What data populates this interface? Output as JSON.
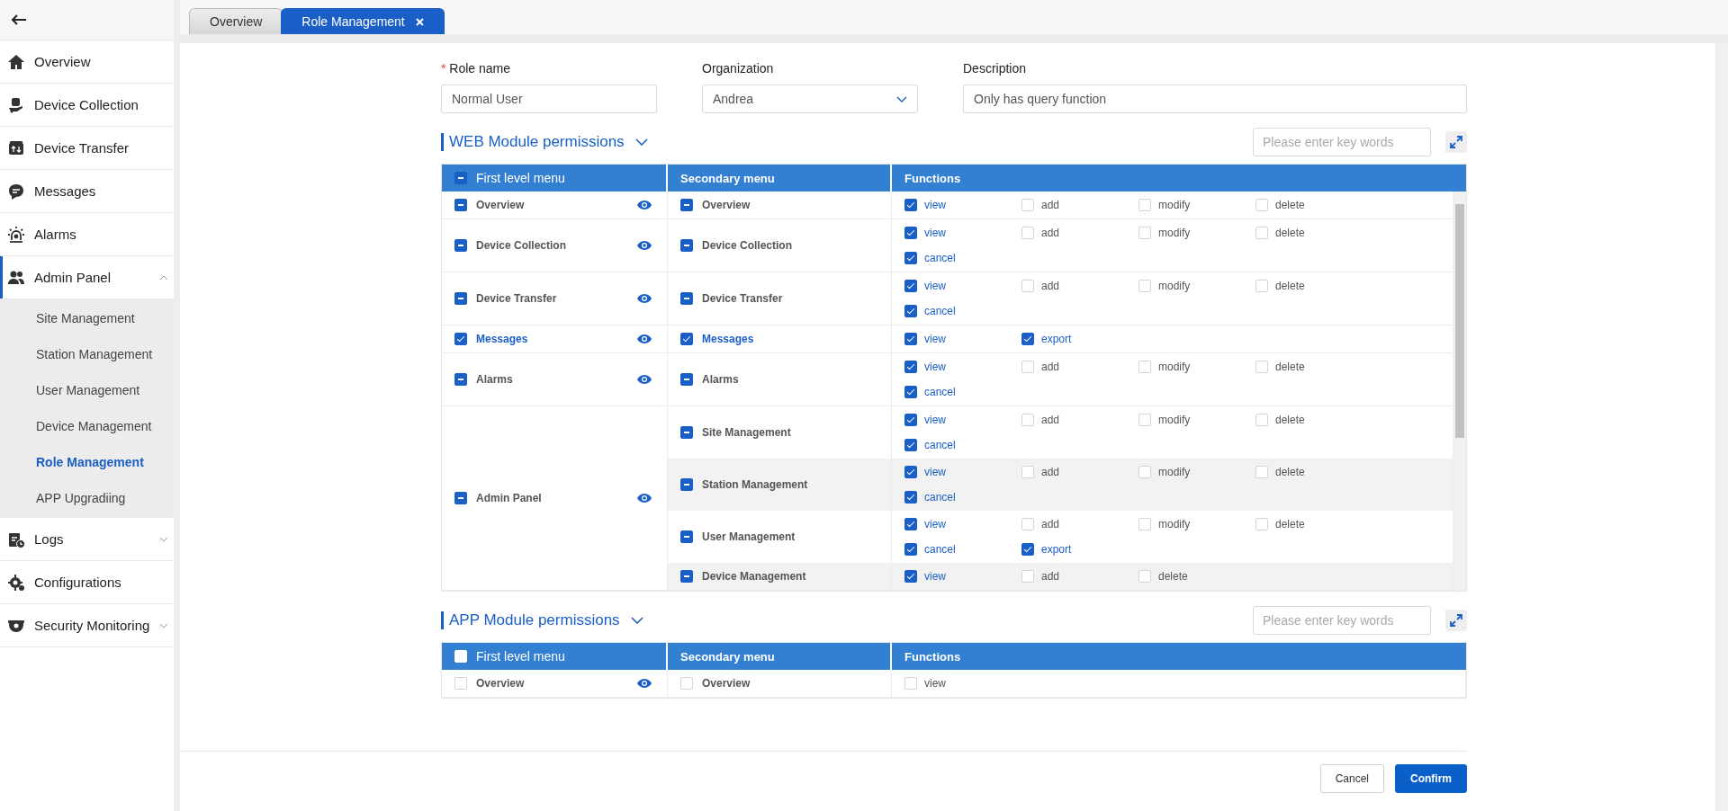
{
  "sidebar": {
    "items": [
      {
        "label": "Overview",
        "selected": false
      },
      {
        "label": "Device Collection",
        "selected": false
      },
      {
        "label": "Device Transfer",
        "selected": false
      },
      {
        "label": "Messages",
        "selected": false
      },
      {
        "label": "Alarms",
        "selected": false
      },
      {
        "label": "Admin Panel",
        "selected": true,
        "expanded": true,
        "children": [
          {
            "label": "Site Management",
            "selected": false
          },
          {
            "label": "Station Management",
            "selected": false
          },
          {
            "label": "User Management",
            "selected": false
          },
          {
            "label": "Device Management",
            "selected": false
          },
          {
            "label": "Role Management",
            "selected": true
          },
          {
            "label": "APP Upgradiing",
            "selected": false
          }
        ]
      },
      {
        "label": "Logs",
        "selected": false,
        "expanded": false
      },
      {
        "label": "Configurations",
        "selected": false
      },
      {
        "label": "Security Monitoring",
        "selected": false,
        "expanded": false
      }
    ]
  },
  "tabs": [
    {
      "label": "Overview",
      "selected": false,
      "closable": false
    },
    {
      "label": "Role Management",
      "selected": true,
      "closable": true
    }
  ],
  "form": {
    "role_name": {
      "label": "Role name",
      "required": true,
      "required_mark": "*",
      "value": "Normal User"
    },
    "organization": {
      "label": "Organization",
      "value": "Andrea"
    },
    "description": {
      "label": "Description",
      "value": "Only has query function"
    }
  },
  "web": {
    "title": "WEB Module permissions",
    "search_placeholder": "Please enter key words",
    "header_checked": true,
    "header_partial": true,
    "columns": [
      "First level menu",
      "Secondary menu",
      "Functions"
    ],
    "rows": [
      {
        "name": "Overview",
        "checked": true,
        "partial": true,
        "children": [
          {
            "name": "Overview",
            "checked": true,
            "partial": true,
            "functions": [
              {
                "label": "view",
                "checked": true
              },
              {
                "label": "add",
                "checked": false
              },
              {
                "label": "modify",
                "checked": false
              },
              {
                "label": "delete",
                "checked": false
              }
            ]
          }
        ]
      },
      {
        "name": "Device Collection",
        "checked": true,
        "partial": true,
        "children": [
          {
            "name": "Device Collection",
            "checked": true,
            "partial": true,
            "functions": [
              {
                "label": "view",
                "checked": true
              },
              {
                "label": "add",
                "checked": false
              },
              {
                "label": "modify",
                "checked": false
              },
              {
                "label": "delete",
                "checked": false
              },
              {
                "label": "cancel",
                "checked": true
              }
            ]
          }
        ]
      },
      {
        "name": "Device Transfer",
        "checked": true,
        "partial": true,
        "children": [
          {
            "name": "Device Transfer",
            "checked": true,
            "partial": true,
            "functions": [
              {
                "label": "view",
                "checked": true
              },
              {
                "label": "add",
                "checked": false
              },
              {
                "label": "modify",
                "checked": false
              },
              {
                "label": "delete",
                "checked": false
              },
              {
                "label": "cancel",
                "checked": true
              }
            ]
          }
        ]
      },
      {
        "name": "Messages",
        "checked": true,
        "partial": false,
        "children": [
          {
            "name": "Messages",
            "checked": true,
            "partial": false,
            "functions": [
              {
                "label": "view",
                "checked": true
              },
              {
                "label": "export",
                "checked": true
              }
            ]
          }
        ]
      },
      {
        "name": "Alarms",
        "checked": true,
        "partial": true,
        "children": [
          {
            "name": "Alarms",
            "checked": true,
            "partial": true,
            "functions": [
              {
                "label": "view",
                "checked": true
              },
              {
                "label": "add",
                "checked": false
              },
              {
                "label": "modify",
                "checked": false
              },
              {
                "label": "delete",
                "checked": false
              },
              {
                "label": "cancel",
                "checked": true
              }
            ]
          }
        ]
      },
      {
        "name": "Admin Panel",
        "checked": true,
        "partial": true,
        "children": [
          {
            "name": "Site Management",
            "checked": true,
            "partial": true,
            "functions": [
              {
                "label": "view",
                "checked": true
              },
              {
                "label": "add",
                "checked": false
              },
              {
                "label": "modify",
                "checked": false
              },
              {
                "label": "delete",
                "checked": false
              },
              {
                "label": "cancel",
                "checked": true
              }
            ]
          },
          {
            "name": "Station Management",
            "checked": true,
            "partial": true,
            "functions": [
              {
                "label": "view",
                "checked": true
              },
              {
                "label": "add",
                "checked": false
              },
              {
                "label": "modify",
                "checked": false
              },
              {
                "label": "delete",
                "checked": false
              },
              {
                "label": "cancel",
                "checked": true
              }
            ]
          },
          {
            "name": "User Management",
            "checked": true,
            "partial": true,
            "functions": [
              {
                "label": "view",
                "checked": true
              },
              {
                "label": "add",
                "checked": false
              },
              {
                "label": "modify",
                "checked": false
              },
              {
                "label": "delete",
                "checked": false
              },
              {
                "label": "cancel",
                "checked": true
              },
              {
                "label": "export",
                "checked": true
              }
            ]
          },
          {
            "name": "Device Management",
            "checked": true,
            "partial": true,
            "functions": [
              {
                "label": "view",
                "checked": true
              },
              {
                "label": "add",
                "checked": false
              },
              {
                "label": "delete",
                "checked": false
              }
            ]
          }
        ]
      }
    ]
  },
  "app": {
    "title": "APP Module permissions",
    "search_placeholder": "Please enter key words",
    "header_checked": false,
    "header_partial": false,
    "columns": [
      "First level menu",
      "Secondary menu",
      "Functions"
    ],
    "rows": [
      {
        "name": "Overview",
        "checked": false,
        "partial": false,
        "children": [
          {
            "name": "Overview",
            "checked": false,
            "partial": false,
            "functions": [
              {
                "label": "view",
                "checked": false
              }
            ]
          }
        ]
      }
    ]
  },
  "buttons": [
    {
      "label": "Cancel",
      "kind": "default"
    },
    {
      "label": "Confirm",
      "kind": "primary"
    }
  ]
}
